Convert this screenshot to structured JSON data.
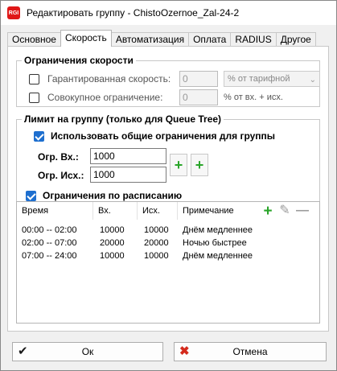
{
  "window": {
    "icon_text": "RGI",
    "title": "Редактировать группу - ChistoOzernoe_Zal-24-2"
  },
  "tabs": [
    {
      "label": "Основное"
    },
    {
      "label": "Скорость"
    },
    {
      "label": "Автоматизация"
    },
    {
      "label": "Оплата"
    },
    {
      "label": "RADIUS"
    },
    {
      "label": "Другое"
    }
  ],
  "active_tab": "Скорость",
  "speed_limits": {
    "title": "Ограничения скорости",
    "guaranteed": {
      "label": "Гарантированная скорость:",
      "checked": false,
      "value": "0",
      "unit_select": "% от тарифной"
    },
    "total": {
      "label": "Совокупное ограничение:",
      "checked": false,
      "value": "0",
      "unit": "% от вх. + исх."
    }
  },
  "group_limit": {
    "title": "Лимит на группу (только для Queue Tree)",
    "use_common": {
      "label": "Использовать общие ограничения для группы",
      "checked": true
    },
    "in_label": "Огр. Вх.:",
    "in_value": "1000",
    "out_label": "Огр. Исх.:",
    "out_value": "1000"
  },
  "schedule": {
    "label": "Ограничения по расписанию",
    "checked": true,
    "columns": [
      "Время",
      "Вх.",
      "Исх.",
      "Примечание"
    ],
    "rows": [
      {
        "time": "00:00 -- 02:00",
        "in": "10000",
        "out": "10000",
        "note": "Днём медленнее"
      },
      {
        "time": "02:00 -- 07:00",
        "in": "20000",
        "out": "20000",
        "note": "Ночью быстрее"
      },
      {
        "time": "07:00 -- 24:00",
        "in": "10000",
        "out": "10000",
        "note": "Днём медленнее"
      }
    ]
  },
  "buttons": {
    "ok": "Ок",
    "cancel": "Отмена"
  },
  "colors": {
    "accent": "#1e6fcf",
    "plus_green": "#2aa52a",
    "cancel_red": "#d42a1c"
  }
}
